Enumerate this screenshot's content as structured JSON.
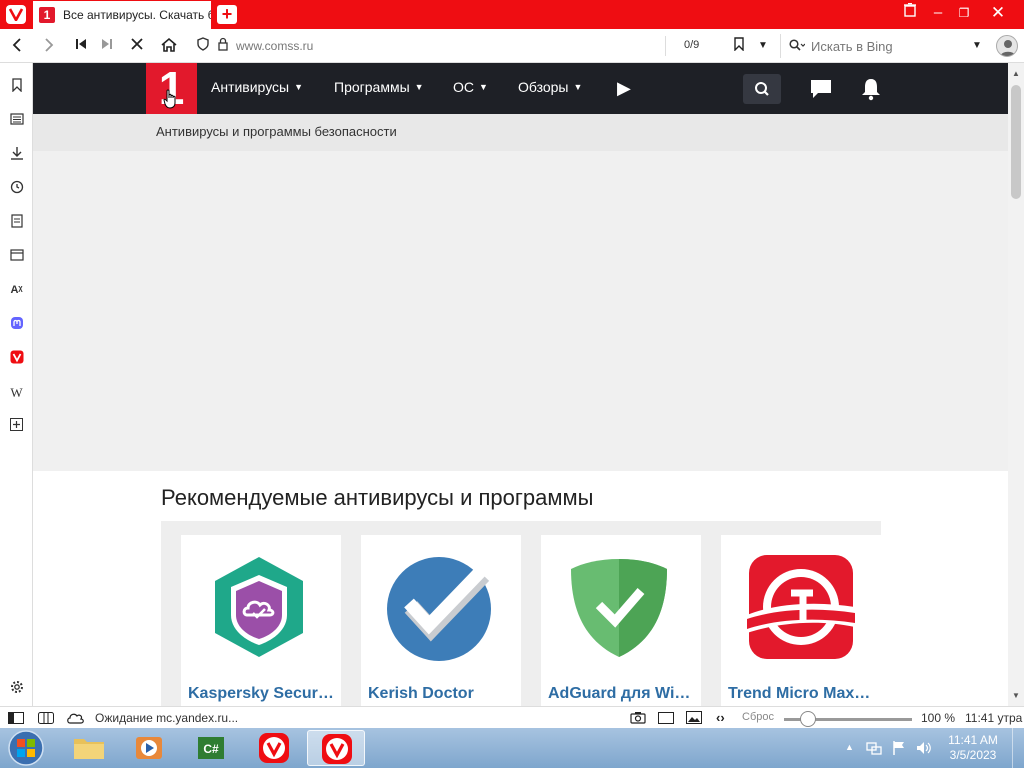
{
  "browser": {
    "tab_title": "Все антивирусы. Скачать б",
    "tab_favicon": "1",
    "url": "www.comss.ru",
    "find_count": "0/9",
    "search_placeholder": "Искать в Bing",
    "accent_color": "#ef0d12"
  },
  "site": {
    "logo_text": "1",
    "menu": [
      {
        "label": "Антивирусы"
      },
      {
        "label": "Программы"
      },
      {
        "label": "ОС"
      },
      {
        "label": "Обзоры"
      }
    ],
    "subheader": "Антивирусы и программы безопасности",
    "section_title": "Рекомендуемые антивирусы и программы",
    "cards": [
      {
        "name": "Kaspersky Secur…",
        "icon": "kaspersky-logo"
      },
      {
        "name": "Kerish Doctor",
        "icon": "kerish-doctor-logo"
      },
      {
        "name": "AdGuard для Wi…",
        "icon": "adguard-logo"
      },
      {
        "name": "Trend Micro Max…",
        "icon": "trend-micro-logo"
      }
    ]
  },
  "statusbar": {
    "status_text": "Ожидание mc.yandex.ru...",
    "reset_label": "Сброс",
    "zoom": "100 %",
    "time": "11:41 утра"
  },
  "taskbar": {
    "time": "11:41 AM",
    "date": "3/5/2023"
  }
}
